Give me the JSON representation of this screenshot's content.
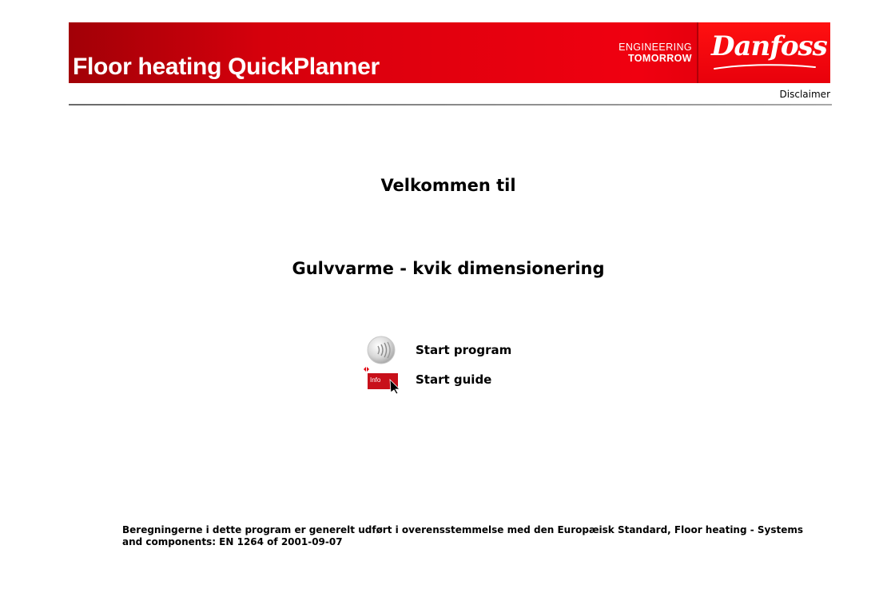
{
  "header": {
    "title": "Floor heating QuickPlanner",
    "tagline_line1": "ENGINEERING",
    "tagline_line2": "TOMORROW",
    "brand": "Danfoss",
    "brand_color": "#e2000f"
  },
  "toplinks": {
    "disclaimer": "Disclaimer"
  },
  "main": {
    "welcome": "Velkommen til",
    "subtitle": "Gulvvarme - kvik dimensionering"
  },
  "actions": [
    {
      "label": "Start program",
      "icon": "sound-disc-icon"
    },
    {
      "label": "Start guide",
      "icon": "info-cursor-icon",
      "icon_text": "Info"
    }
  ],
  "footer": {
    "note": "Beregningerne i dette program er generelt udført i overensstemmelse med den Europæisk Standard, Floor heating - Systems and components: EN 1264 of 2001-09-07"
  }
}
